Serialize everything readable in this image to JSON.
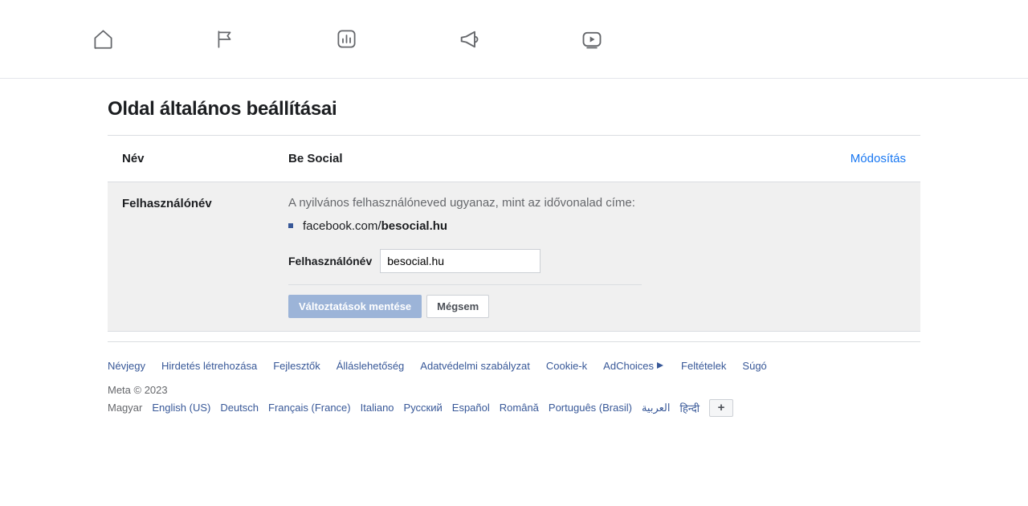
{
  "page": {
    "title": "Oldal általános beállításai"
  },
  "nameRow": {
    "label": "Név",
    "value": "Be Social",
    "editLabel": "Módosítás"
  },
  "usernameRow": {
    "label": "Felhasználónév",
    "helper": "A nyilvános felhasználóneved ugyanaz, mint az idővonalad címe:",
    "urlPrefix": "facebook.com/",
    "urlUsername": "besocial.hu",
    "inputLabel": "Felhasználónév",
    "inputValue": "besocial.hu",
    "saveLabel": "Változtatások mentése",
    "cancelLabel": "Mégsem"
  },
  "footer": {
    "links": [
      "Névjegy",
      "Hirdetés létrehozása",
      "Fejlesztők",
      "Álláslehetőség",
      "Adatvédelmi szabályzat",
      "Cookie-k",
      "AdChoices",
      "Feltételek",
      "Súgó"
    ],
    "copyright": "Meta © 2023",
    "currentLang": "Magyar",
    "languages": [
      "English (US)",
      "Deutsch",
      "Français (France)",
      "Italiano",
      "Русский",
      "Español",
      "Română",
      "Português (Brasil)",
      "العربية",
      "हिन्दी"
    ]
  }
}
